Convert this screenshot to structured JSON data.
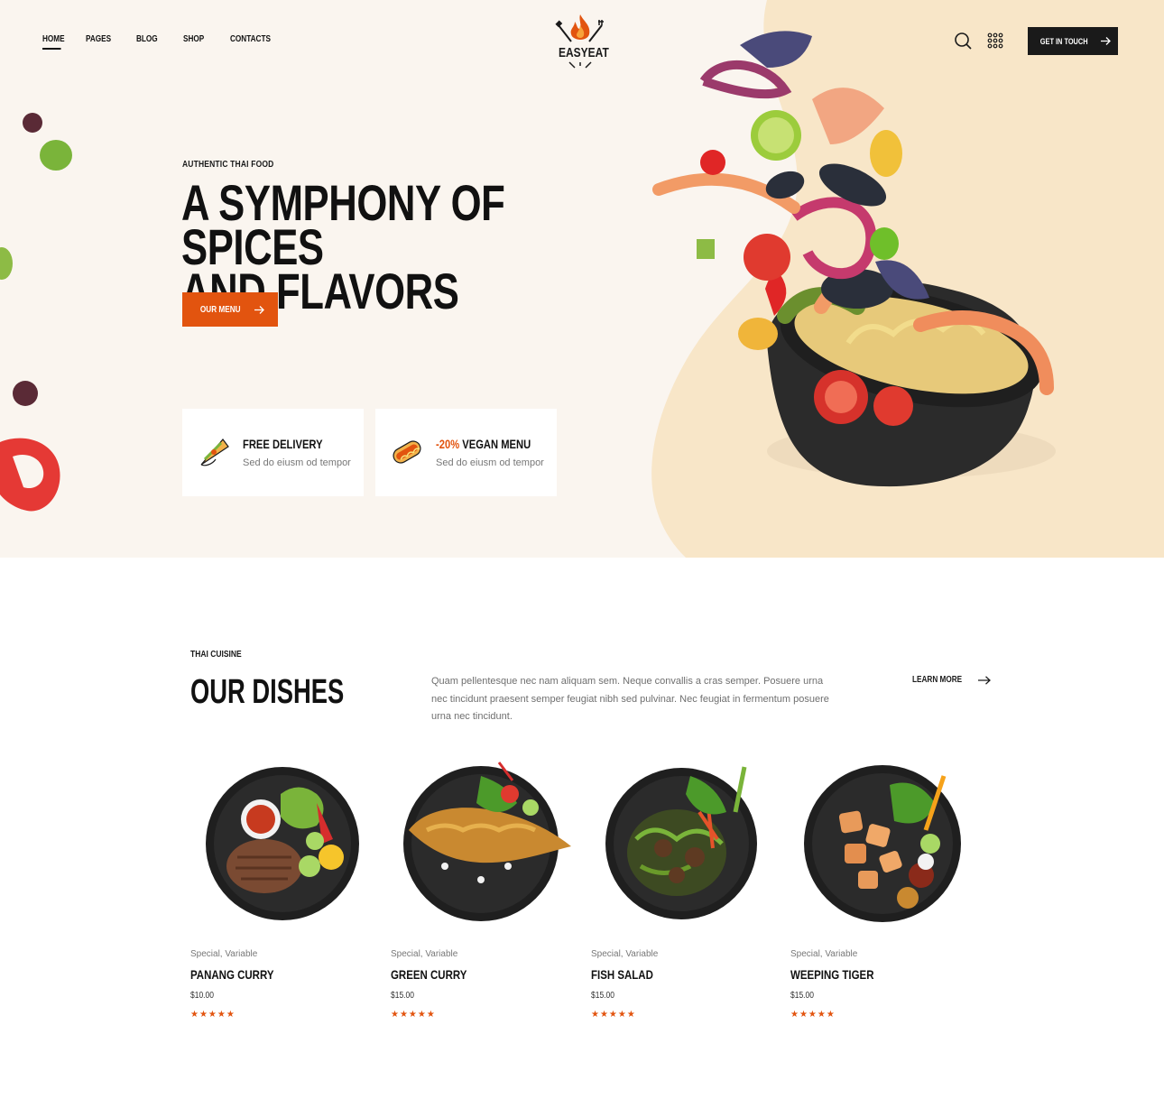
{
  "nav": {
    "items": [
      {
        "label": "HOME",
        "active": true
      },
      {
        "label": "PAGES"
      },
      {
        "label": "BLOG"
      },
      {
        "label": "SHOP"
      },
      {
        "label": "CONTACTS"
      }
    ]
  },
  "brand": {
    "name": "EASYEAT"
  },
  "header": {
    "search_icon": "search-icon",
    "menu_icon": "grid-dots-icon",
    "cta_label": "GET IN TOUCH"
  },
  "hero": {
    "eyebrow": "AUTHENTIC THAI FOOD",
    "title_line1": "A SYMPHONY OF SPICES",
    "title_line2": "AND FLAVORS",
    "button_label": "OUR MENU",
    "features": [
      {
        "title": "FREE DELIVERY",
        "accent": "",
        "desc": "Sed do eiusm od tempor",
        "icon": "taco-icon"
      },
      {
        "title": "VEGAN MENU",
        "accent": "-20%",
        "desc": "Sed do eiusm od tempor",
        "icon": "hotdog-icon"
      }
    ]
  },
  "dishes_section": {
    "eyebrow": "THAI CUISINE",
    "title": "OUR DISHES",
    "description": "Quam pellentesque nec nam aliquam sem. Neque convallis a cras semper. Posuere urna nec tincidunt praesent semper feugiat nibh sed pulvinar. Nec feugiat in fermentum posuere urna nec tincidunt.",
    "learn_more": "LEARN MORE",
    "items": [
      {
        "category": "Special, Variable",
        "name": "PANANG CURRY",
        "price": "$10.00",
        "rating": 5
      },
      {
        "category": "Special, Variable",
        "name": "GREEN CURRY",
        "price": "$15.00",
        "rating": 5
      },
      {
        "category": "Special, Variable",
        "name": "FISH SALAD",
        "price": "$15.00",
        "rating": 5
      },
      {
        "category": "Special, Variable",
        "name": "WEEPING TIGER",
        "price": "$15.00",
        "rating": 5
      }
    ]
  },
  "colors": {
    "accent": "#e2540f",
    "dark": "#1a1a1a",
    "hero_bg": "#faf5ef",
    "blob": "#f8e6c8"
  }
}
